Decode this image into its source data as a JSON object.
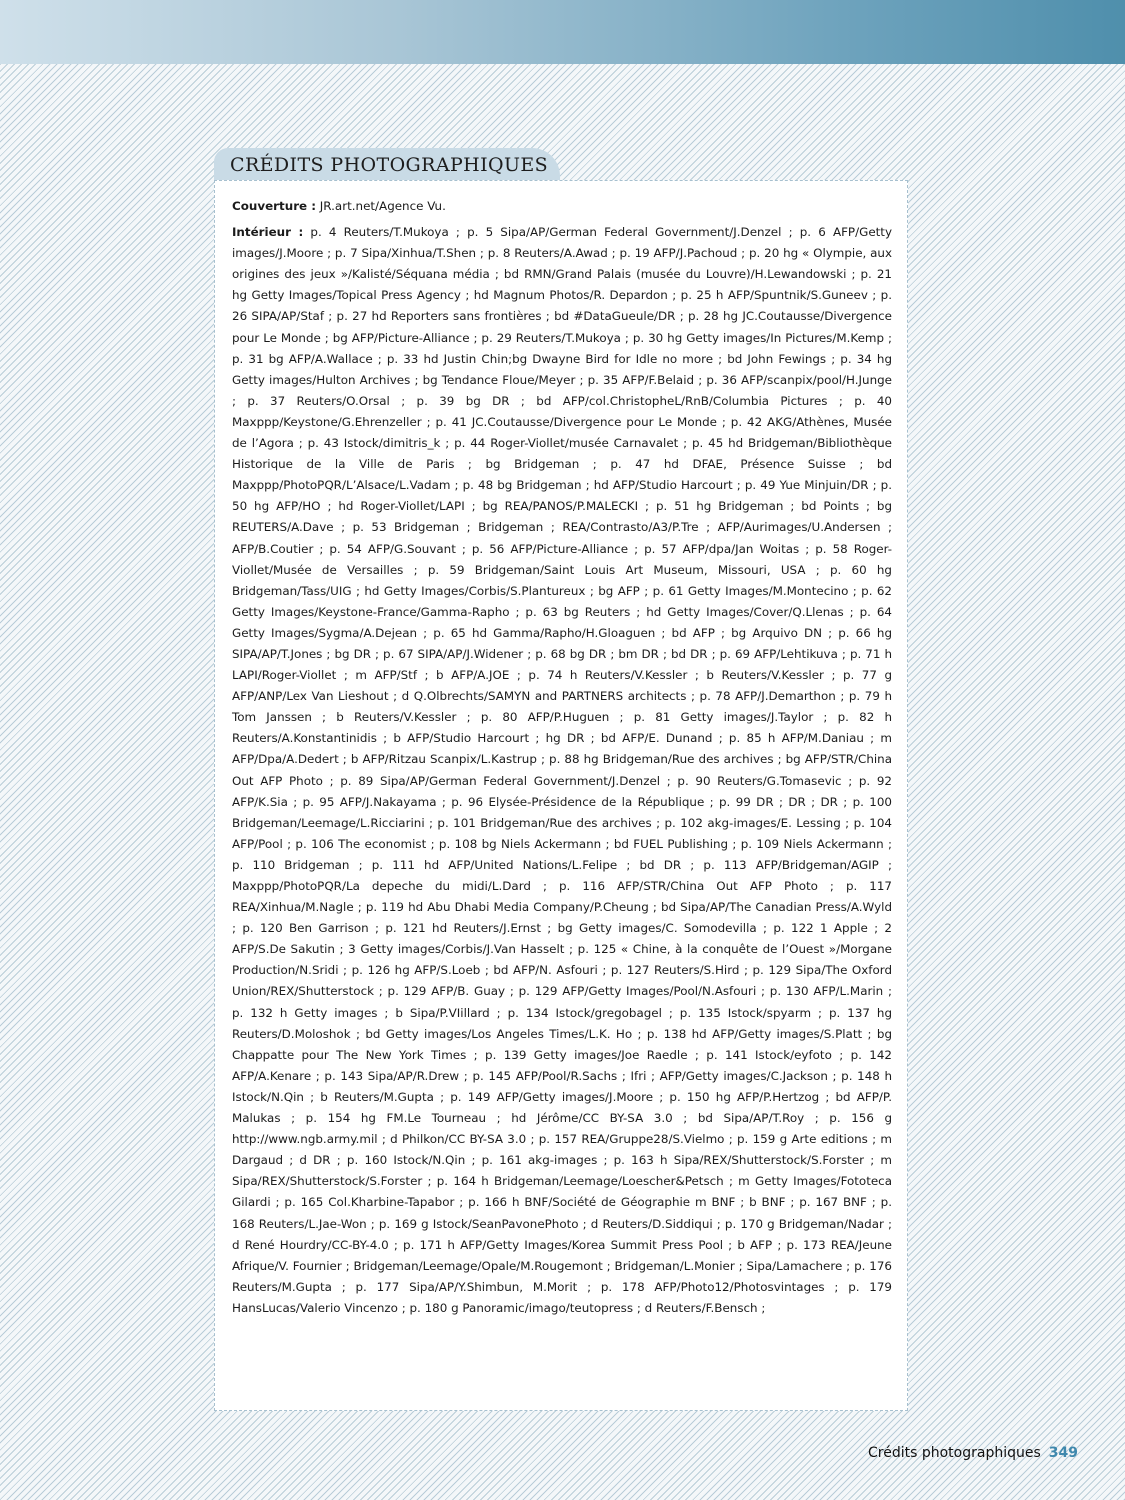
{
  "section_title": "CRÉDITS PHOTOGRAPHIQUES",
  "cover": {
    "label": "Couverture :",
    "text": " JR.art.net/Agence Vu."
  },
  "interior": {
    "label": "Intérieur :",
    "text": " p. 4 Reuters/T.Mukoya ; p. 5 Sipa/AP/German Federal Government/J.Denzel ; p. 6 AFP/Getty images/J.Moore ; p. 7 Sipa/Xinhua/T.Shen ; p. 8 Reuters/A.Awad ; p. 19 AFP/J.Pachoud ; p. 20 hg « Olympie, aux origines des jeux »/Kalisté/Séquana média ; bd RMN/Grand Palais (musée du Louvre)/H.Lewandowski ; p. 21 hg Getty Images/Topical Press Agency ; hd Magnum Photos/R. Depardon ; p. 25 h AFP/Spuntnik/S.Guneev ; p. 26 SIPA/AP/Staf ; p. 27 hd Reporters sans frontières ; bd #DataGueule/DR ; p. 28 hg JC.Coutausse/Divergence pour Le Monde ; bg AFP/Picture-Alliance ; p. 29 Reuters/T.Mukoya ; p. 30 hg Getty images/In Pictures/M.Kemp ; p. 31 bg AFP/A.Wallace ; p. 33 hd Justin Chin;bg Dwayne Bird for Idle no more ; bd John Fewings ; p. 34 hg Getty images/Hulton Archives ; bg Tendance Floue/Meyer ; p. 35 AFP/F.Belaid ; p. 36 AFP/scanpix/pool/H.Junge ; p. 37 Reuters/O.Orsal ; p. 39 bg DR ; bd AFP/col.ChristopheL/RnB/Columbia Pictures ; p. 40 Maxppp/Keystone/G.Ehrenzeller ; p. 41 JC.Coutausse/Divergence pour Le Monde ; p. 42 AKG/Athènes, Musée de l’Agora ; p. 43 Istock/dimitris_k ; p. 44 Roger-Viollet/musée Carnavalet ; p. 45 hd Bridgeman/Bibliothèque Historique de la Ville de Paris ; bg Bridgeman ; p. 47 hd DFAE, Présence Suisse ; bd Maxppp/PhotoPQR/L’Alsace/L.Vadam ; p. 48 bg Bridgeman ; hd AFP/Studio Harcourt ; p. 49 Yue Minjuin/DR ; p. 50 hg AFP/HO ; hd Roger-Viollet/LAPI ; bg REA/PANOS/P.MALECKI ; p. 51 hg Bridgeman ; bd Points ; bg REUTERS/A.Dave ; p. 53 Bridgeman ; Bridgeman ; REA/Contrasto/A3/P.Tre ; AFP/Aurimages/U.Andersen ; AFP/B.Coutier ; p. 54 AFP/G.Souvant ; p. 56 AFP/Picture-Alliance ; p. 57 AFP/dpa/Jan Woitas ; p. 58 Roger-Viollet/Musée de Versailles ; p. 59 Bridgeman/Saint Louis Art Museum, Missouri, USA ; p. 60 hg Bridgeman/Tass/UIG ; hd Getty Images/Corbis/S.Plantureux ; bg AFP ; p. 61 Getty Images/M.Montecino ; p. 62 Getty Images/Keystone-France/Gamma-Rapho ; p. 63 bg Reuters ; hd Getty Images/Cover/Q.Llenas ; p. 64 Getty Images/Sygma/A.Dejean ; p. 65 hd Gamma/Rapho/H.Gloaguen ; bd AFP ; bg Arquivo DN ; p. 66 hg SIPA/AP/T.Jones ; bg DR ; p. 67 SIPA/AP/J.Widener ; p. 68 bg DR ; bm DR ; bd DR ; p. 69 AFP/Lehtikuva ; p. 71 h LAPI/Roger-Viollet ; m AFP/Stf ; b AFP/A.JOE ; p. 74 h Reuters/V.Kessler ; b Reuters/V.Kessler ; p. 77 g AFP/ANP/Lex Van Lieshout ; d Q.Olbrechts/SAMYN and PARTNERS architects ; p. 78 AFP/J.Demarthon ; p. 79 h Tom Janssen ; b Reuters/V.Kessler ; p. 80 AFP/P.Huguen ; p. 81 Getty images/J.Taylor ; p. 82 h Reuters/A.Konstantinidis ; b AFP/Studio Harcourt ; hg DR ; bd AFP/E. Dunand ; p. 85 h AFP/M.Daniau ; m AFP/Dpa/A.Dedert ; b AFP/Ritzau Scanpix/L.Kastrup ; p. 88 hg Bridgeman/Rue des archives ; bg AFP/STR/China Out AFP Photo ; p. 89 Sipa/AP/German Federal Government/J.Denzel ; p. 90 Reuters/G.Tomasevic ; p. 92 AFP/K.Sia ; p. 95 AFP/J.Nakayama ; p. 96 Elysée-Présidence de la République ; p. 99 DR ; DR ; DR ; p. 100 Bridgeman/Leemage/L.Ricciarini ; p. 101 Bridgeman/Rue des archives ; p. 102 akg-images/E. Lessing ; p. 104 AFP/Pool ; p. 106 The economist ; p. 108 bg Niels Ackermann ; bd FUEL Publishing ; p. 109 Niels Ackermann ; p. 110 Bridgeman ; p. 111 hd AFP/United Nations/L.Felipe ; bd DR ; p. 113 AFP/Bridgeman/AGIP ; Maxppp/PhotoPQR/La depeche du midi/L.Dard ; p. 116 AFP/STR/China Out AFP Photo ; p. 117 REA/Xinhua/M.Nagle ; p. 119 hd Abu Dhabi Media Company/P.Cheung ; bd Sipa/AP/The Canadian Press/A.Wyld ; p. 120 Ben Garrison ; p. 121 hd Reuters/J.Ernst ; bg Getty images/C. Somodevilla ; p. 122 1 Apple ; 2 AFP/S.De Sakutin ; 3 Getty images/Corbis/J.Van Hasselt ; p. 125 « Chine, à la conquête de l’Ouest »/Morgane Production/N.Sridi ; p. 126 hg AFP/S.Loeb ; bd AFP/N. Asfouri ; p. 127 Reuters/S.Hird ; p. 129 Sipa/The Oxford Union/REX/Shutterstock ; p. 129 AFP/B. Guay ; p. 129 AFP/Getty Images/Pool/N.Asfouri ; p. 130 AFP/L.Marin ; p. 132 h Getty images ; b Sipa/P.VIillard ; p. 134 Istock/gregobagel ; p. 135 Istock/spyarm ; p. 137 hg Reuters/D.Moloshok ; bd Getty images/Los Angeles Times/L.K. Ho ; p. 138 hd AFP/Getty images/S.Platt ; bg Chappatte pour The New York Times ; p. 139 Getty images/Joe Raedle ; p. 141 Istock/eyfoto ; p. 142 AFP/A.Kenare ; p. 143 Sipa/AP/R.Drew ; p. 145 AFP/Pool/R.Sachs ; Ifri ; AFP/Getty images/C.Jackson ; p. 148 h Istock/N.Qin ; b Reuters/M.Gupta ; p. 149 AFP/Getty images/J.Moore ; p. 150 hg AFP/P.Hertzog ; bd AFP/P. Malukas ; p. 154 hg FM.Le Tourneau ; hd Jérôme/CC BY-SA 3.0 ; bd Sipa/AP/T.Roy ; p. 156 g http://www.ngb.army.mil ; d Philkon/CC BY-SA 3.0 ; p. 157 REA/Gruppe28/S.Vielmo ; p. 159 g Arte editions ; m Dargaud ; d DR ; p. 160 Istock/N.Qin ; p. 161 akg-images ; p. 163 h Sipa/REX/Shutterstock/S.Forster ; m Sipa/REX/Shutterstock/S.Forster ; p. 164 h Bridgeman/Leemage/Loescher&Petsch ; m Getty Images/Fototeca Gilardi ; p. 165 Col.Kharbine-Tapabor ; p. 166 h BNF/Société de Géographie m BNF ; b BNF ; p. 167 BNF ; p. 168 Reuters/L.Jae-Won ; p. 169 g Istock/SeanPavonePhoto ; d Reuters/D.Siddiqui ; p. 170 g Bridgeman/Nadar ; d René Hourdry/CC-BY-4.0 ; p. 171 h AFP/Getty Images/Korea Summit Press Pool ; b AFP ; p. 173 REA/Jeune Afrique/V. Fournier ; Bridgeman/Leemage/Opale/M.Rougemont ; Bridgeman/L.Monier ; Sipa/Lamachere ; p. 176 Reuters/M.Gupta ; p. 177 Sipa/AP/Y.Shimbun, M.Morit ; p. 178 AFP/Photo12/Photosvintages ; p. 179 HansLucas/Valerio Vincenzo ; p. 180 g Panoramic/imago/teutopress ; d Reuters/F.Bensch ;"
  },
  "footer": {
    "label": "Crédits photographiques",
    "page_number": "349"
  }
}
